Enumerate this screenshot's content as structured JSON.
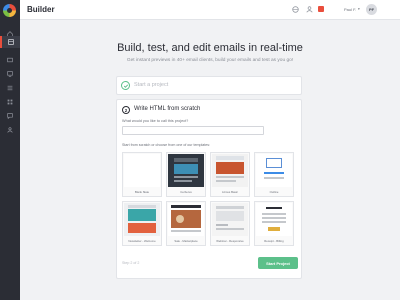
{
  "header": {
    "title": "Builder",
    "user": {
      "name": "Paul F.",
      "caret": "▾",
      "initials": "PF"
    },
    "icons": [
      "globe-icon",
      "user-icon",
      "notification-icon"
    ]
  },
  "sidebar": {
    "items": [
      {
        "icon": "home-icon",
        "active": false
      },
      {
        "icon": "builder-icon",
        "active": true
      },
      {
        "icon": "test-icon",
        "active": false
      },
      {
        "icon": "monitor-icon",
        "active": false
      },
      {
        "icon": "list-icon",
        "active": false
      },
      {
        "icon": "grid-icon",
        "active": false
      },
      {
        "icon": "chat-icon",
        "active": false
      },
      {
        "icon": "person-icon",
        "active": false
      }
    ]
  },
  "hero": {
    "title": "Build, test, and edit emails in real-time",
    "subtitle": "Get instant previews in 40+ email clients, build your emails and test as you go!"
  },
  "step1": {
    "label": "Start a project",
    "completed": true
  },
  "step2": {
    "number": "2",
    "title": "Write HTML from scratch",
    "name_label": "What would you like to call this project?",
    "name_value": "",
    "templates_label": "Start from scratch or choose from one of our templates:",
    "templates": [
      {
        "name": "Blank Slate"
      },
      {
        "name": "Cerberus"
      },
      {
        "name": "Litmus Basic"
      },
      {
        "name": "Outline"
      },
      {
        "name": "Newsletter - Welcome"
      },
      {
        "name": "Sale - Marketplace"
      },
      {
        "name": "Webinar - Responsive"
      },
      {
        "name": "Receipt - Billing"
      }
    ]
  },
  "footer": {
    "step_count": "Step 2 of 2",
    "start_button": "Start Project"
  },
  "colors": {
    "accent": "#5cc08a",
    "sidebar": "#2b2d35",
    "alert": "#e94e3c"
  }
}
